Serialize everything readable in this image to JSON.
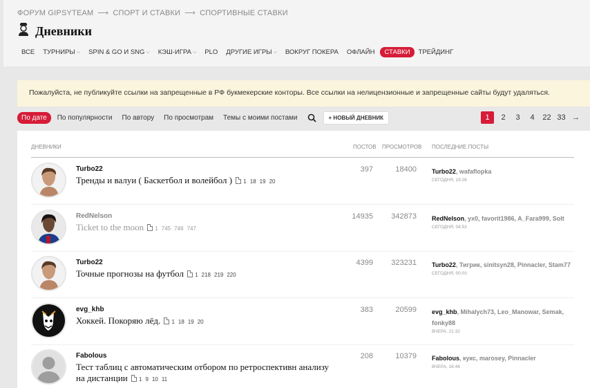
{
  "breadcrumbs": [
    "ФОРУМ GIPSYTEAM",
    "СПОРТ И СТАВКИ",
    "СПОРТИВНЫЕ СТАВКИ"
  ],
  "page_title": "Дневники",
  "nav": [
    {
      "label": "ВСЕ",
      "dropdown": false,
      "active": false
    },
    {
      "label": "ТУРНИРЫ",
      "dropdown": true,
      "active": false
    },
    {
      "label": "SPIN & GO И SNG",
      "dropdown": true,
      "active": false
    },
    {
      "label": "КЭШ-ИГРА",
      "dropdown": true,
      "active": false
    },
    {
      "label": "PLO",
      "dropdown": false,
      "active": false
    },
    {
      "label": "ДРУГИЕ ИГРЫ",
      "dropdown": true,
      "active": false
    },
    {
      "label": "ВОКРУГ ПОКЕРА",
      "dropdown": false,
      "active": false
    },
    {
      "label": "ОФЛАЙН",
      "dropdown": false,
      "active": false
    },
    {
      "label": "СТАВКИ",
      "dropdown": false,
      "active": true
    },
    {
      "label": "ТРЕЙДИНГ",
      "dropdown": false,
      "active": false
    }
  ],
  "notice": "Пожалуйста, не публикуйте ссылки на запрещенные в РФ букмекерские конторы. Все ссылки на нелицензионные и запрещенные сайты будут удаляться.",
  "filters": [
    "По дате",
    "По популярности",
    "По автору",
    "По просмотрам",
    "Темы с моими постами"
  ],
  "new_diary_button": "+ НОВЫЙ ДНЕВНИК",
  "pager": {
    "pages": [
      "1",
      "2",
      "3",
      "4",
      "22",
      "33"
    ],
    "current": "1",
    "next": "→"
  },
  "columns": {
    "diaries": "ДНЕВНИКИ",
    "posts": "ПОСТОВ",
    "views": "ПРОСМОТРОВ",
    "last_posts": "ПОСЛЕДНИЕ ПОСТЫ"
  },
  "rows": [
    {
      "author": "Turbo22",
      "title": "Тренды и валуи ( Баскетбол и волейбол )",
      "pages": [
        "1",
        "18",
        "19",
        "20"
      ],
      "posts": "397",
      "views": "18400",
      "last_authors": "Turbo22, wafaflopka",
      "last_time": "СЕГОДНЯ, 19:26",
      "read": false,
      "avatar": "man-light"
    },
    {
      "author": "RedNelson",
      "title": "Ticket to the moon",
      "pages": [
        "1",
        "745",
        "746",
        "747"
      ],
      "posts": "14935",
      "views": "342873",
      "last_authors": "RedNelson, yx0, favorit1986, A_Fara999, Solt",
      "last_time": "СЕГОДНЯ, 04:53",
      "read": true,
      "avatar": "man-dark"
    },
    {
      "author": "Turbo22",
      "title": "Точные прогнозы на футбол",
      "pages": [
        "1",
        "218",
        "219",
        "220"
      ],
      "posts": "4399",
      "views": "323231",
      "last_authors": "Turbo22, Тигрик, sinitsyn28, Pinnacler, Stam77",
      "last_time": "СЕГОДНЯ, 00:03",
      "read": false,
      "avatar": "man-light"
    },
    {
      "author": "evg_khb",
      "title": "Хоккей. Покоряю лёд.",
      "pages": [
        "1",
        "18",
        "19",
        "20"
      ],
      "posts": "383",
      "views": "20599",
      "last_authors": "evg_khb, Mihalych73, Leo_Manowar, Semak, fonky88",
      "last_time": "ВЧЕРА, 21:32",
      "read": false,
      "avatar": "logo"
    },
    {
      "author": "Fabolous",
      "title": "Тест таблиц с автоматическим отбором по ретроспективн анализу на дистанции",
      "pages": [
        "1",
        "9",
        "10",
        "11"
      ],
      "posts": "208",
      "views": "10379",
      "last_authors": "Fabolous, кукс, marosey, Pinnacler",
      "last_time": "ВЧЕРА, 16:46",
      "read": false,
      "avatar": "default"
    }
  ],
  "colors": {
    "accent": "#d61c38",
    "notice_bg": "#fbf5dd"
  }
}
